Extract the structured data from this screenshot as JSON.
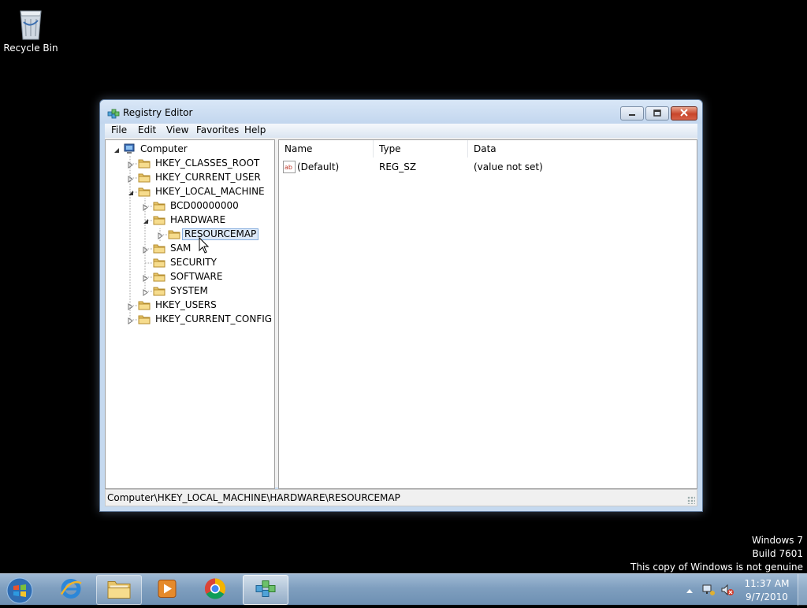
{
  "desktop": {
    "recycle_bin_label": "Recycle Bin",
    "watermark": {
      "line1": "Windows 7",
      "line2": "Build 7601",
      "line3": "This copy of Windows is not genuine"
    }
  },
  "window": {
    "title": "Registry Editor",
    "menu": [
      "File",
      "Edit",
      "View",
      "Favorites",
      "Help"
    ],
    "tree": {
      "root": "Computer",
      "items": [
        {
          "label": "HKEY_CLASSES_ROOT"
        },
        {
          "label": "HKEY_CURRENT_USER"
        },
        {
          "label": "HKEY_LOCAL_MACHINE"
        },
        {
          "label": "BCD00000000"
        },
        {
          "label": "HARDWARE"
        },
        {
          "label": "RESOURCEMAP",
          "selected": true
        },
        {
          "label": "SAM"
        },
        {
          "label": "SECURITY"
        },
        {
          "label": "SOFTWARE"
        },
        {
          "label": "SYSTEM"
        },
        {
          "label": "HKEY_USERS"
        },
        {
          "label": "HKEY_CURRENT_CONFIG"
        }
      ]
    },
    "list": {
      "columns": [
        "Name",
        "Type",
        "Data"
      ],
      "rows": [
        {
          "name": "(Default)",
          "type": "REG_SZ",
          "data": "(value not set)"
        }
      ]
    },
    "status_path": "Computer\\HKEY_LOCAL_MACHINE\\HARDWARE\\RESOURCEMAP"
  },
  "taskbar": {
    "clock_time": "11:37 AM",
    "clock_date": "9/7/2010"
  }
}
